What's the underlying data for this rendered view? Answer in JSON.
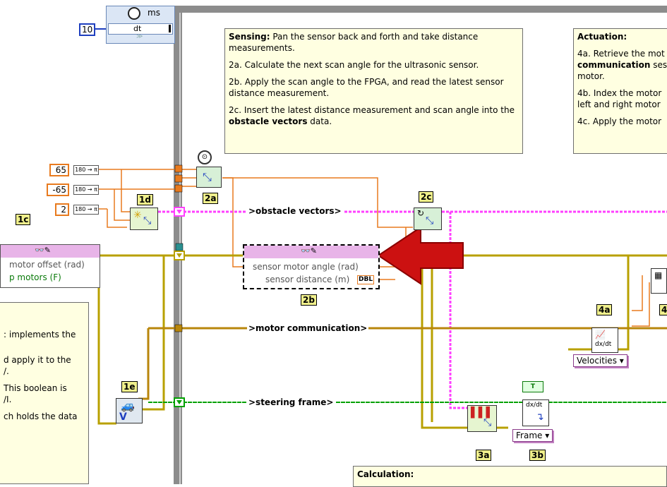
{
  "timer": {
    "unit_label": "ms",
    "dt_label": "dt",
    "dt_value": "10"
  },
  "notes": {
    "sensing_title": "Sensing:",
    "sensing_intro": " Pan the sensor back and forth and take distance measurements.",
    "sensing_2a": "2a. Calculate the next scan angle for the ultrasonic sensor.",
    "sensing_2b": "2b. Apply the scan angle to the FPGA, and read the latest sensor distance measurement.",
    "sensing_2c_pre": "2c. Insert the latest distance measurement and scan angle into the ",
    "sensing_2c_bold": "obstacle vectors",
    "sensing_2c_post": " data.",
    "actuation_title": "Actuation:",
    "actuation_4a_pre": "4a. Retrieve the mot",
    "actuation_4a_bold": "communication",
    "actuation_4a_post": " ses",
    "actuation_4a_line3": "motor.",
    "actuation_4b": "4b. Index the motor",
    "actuation_4b_line2": "left and right motor",
    "actuation_4c": "4c. Apply the motor",
    "left_line1": ": implements the",
    "left_line2": "d apply it to the",
    "left_line3": "/.",
    "left_line4": "This boolean is",
    "left_line5": "/I.",
    "left_line6": "ch holds the data",
    "calc_title": "Calculation:"
  },
  "constants": {
    "c65": "65",
    "cneg65": "-65",
    "c2": "2",
    "conv_label": "180 → π"
  },
  "labels": {
    "l1c": "1c",
    "l1d": "1d",
    "l1e": "1e",
    "l2a": "2a",
    "l2b": "2b",
    "l2c": "2c",
    "l3a": "3a",
    "l3b": "3b",
    "l4a": "4a",
    "l4b": "4"
  },
  "wires": {
    "obstacle_vectors": ">obstacle vectors>",
    "motor_communication": ">motor communication>",
    "steering_frame": ">steering frame>"
  },
  "left_node": {
    "row1": "motor offset (rad)",
    "row2": "p motors (F)"
  },
  "fpga_node": {
    "row1": "sensor motor angle (rad)",
    "row2": "sensor distance (m)",
    "dbl_tag": "DBL"
  },
  "rings": {
    "velocities": "Velocities",
    "frame": "Frame"
  },
  "colors": {
    "orange_wire": "#e87a1e",
    "pink_wire": "#ff40ff",
    "gold_wire": "#b8860b",
    "green_wire": "#00a000",
    "arrow": "#cc1111"
  }
}
